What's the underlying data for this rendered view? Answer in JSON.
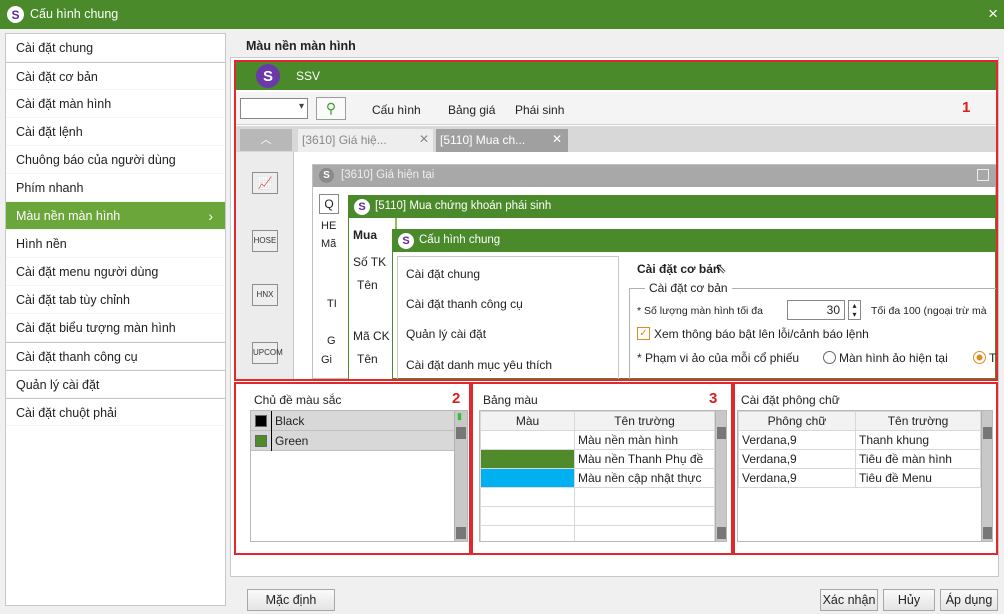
{
  "window": {
    "title": "Cấu hình chung",
    "close": "×"
  },
  "sidebar": {
    "items": [
      {
        "label": "Cài đặt chung"
      },
      {
        "label": "Cài đặt cơ bản"
      },
      {
        "label": "Cài đặt màn hình"
      },
      {
        "label": "Cài đặt lệnh"
      },
      {
        "label": "Chuông báo của người dùng"
      },
      {
        "label": "Phím nhanh"
      },
      {
        "label": "Màu nền màn hình"
      },
      {
        "label": "Hình nền"
      },
      {
        "label": "Cài đặt menu người dùng"
      },
      {
        "label": "Cài đặt tab tùy chỉnh"
      },
      {
        "label": "Cài đặt biểu tượng màn hình"
      },
      {
        "label": "Cài đặt thanh công cụ"
      },
      {
        "label": "Quản lý cài đặt"
      },
      {
        "label": "Cài đặt chuột phải"
      }
    ],
    "chevron": "›"
  },
  "main": {
    "title": "Màu nền màn hình"
  },
  "preview": {
    "app_title": "SSV",
    "menu": [
      "Cấu hình",
      "Bảng giá",
      "Phái sinh"
    ],
    "tabs": [
      "[3610] Giá hiệ...",
      "[5110] Mua ch..."
    ],
    "side_icons": [
      "HOSE",
      "HNX",
      "UPCOM"
    ],
    "win1_title": "[3610] Giá hiện tại",
    "win2_title": "[5110] Mua chứng khoán phái sinh",
    "frag": {
      "q": "Q",
      "he": "HE",
      "ma": "Mã",
      "ti": "TI",
      "g": "G",
      "gi": "Gi",
      "mua": "Mua",
      "so_tk": "Số TK",
      "ten": "Tên",
      "ma_ck": "Mã CK",
      "ten2": "Tên"
    },
    "dlg_title": "Cấu hình chung",
    "dlg_items": [
      "Cài đặt chung",
      "Cài đặt thanh công cụ",
      "Quản lý cài đặt",
      "Cài đặt danh mục yêu thích"
    ],
    "dlg_header": "Cài đặt cơ bản",
    "group": "Cài đặt cơ bản",
    "row1_label": "* Số lượng màn hình tối đa",
    "row1_value": "30",
    "row1_note": "Tối đa 100 (ngoại trừ mà",
    "row2_label": "Xem thông báo bật lên lỗi/cảnh báo lệnh",
    "row3_label": "* Phạm vi ảo của mỗi cổ phiếu",
    "row3_opt1": "Màn hình ảo hiện tại",
    "row3_opt2": "T",
    "marker": "1"
  },
  "themes": {
    "title": "Chủ đề màu sắc",
    "marker": "2",
    "rows": [
      {
        "name": "Black",
        "color": "#000000"
      },
      {
        "name": "Green",
        "color": "#4f8a2b"
      }
    ]
  },
  "palette": {
    "title": "Bảng màu",
    "marker": "3",
    "headers": [
      "Màu",
      "Tên trường"
    ],
    "rows": [
      {
        "color": "#ffffff",
        "name": "Màu nền màn hình"
      },
      {
        "color": "#4f8a2b",
        "name": "Màu nền Thanh Phụ đề"
      },
      {
        "color": "#00b0f0",
        "name": "Màu nền cập nhật thực"
      }
    ]
  },
  "fonts": {
    "title": "Cài đặt phông chữ",
    "headers": [
      "Phông chữ",
      "Tên trường"
    ],
    "rows": [
      {
        "font": "Verdana,9",
        "field": "Thanh khung"
      },
      {
        "font": "Verdana,9",
        "field": "Tiêu đề màn hình"
      },
      {
        "font": "Verdana,9",
        "field": "Tiêu đề Menu"
      }
    ]
  },
  "buttons": {
    "default": "Mặc định",
    "confirm": "Xác nhận",
    "cancel": "Hủy",
    "apply": "Áp dụng"
  },
  "colors": {
    "titlebar": "#4a8a2a",
    "accent": "#6aa63a",
    "marker": "#e0282d"
  }
}
